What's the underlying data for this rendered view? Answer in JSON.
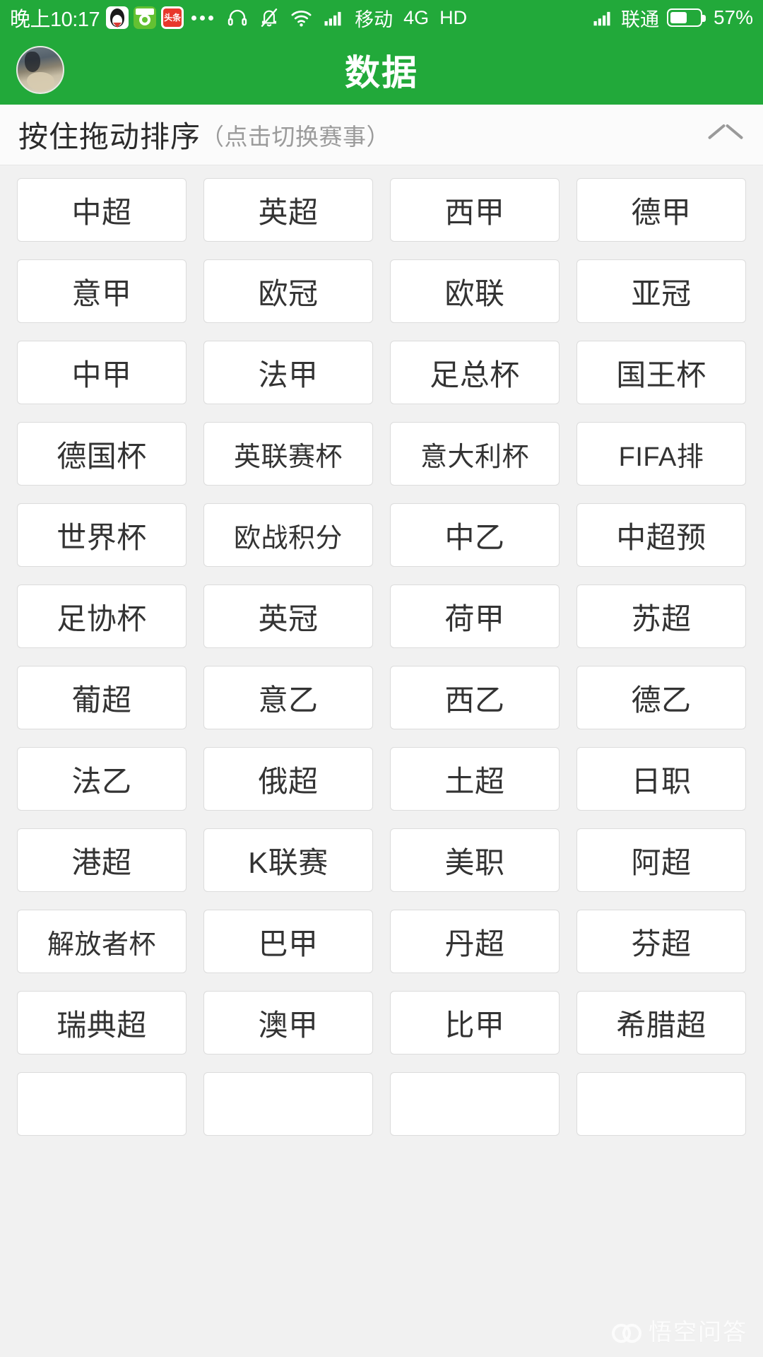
{
  "status_bar": {
    "time": "晚上10:17",
    "app_icons": [
      "qq-icon",
      "green-ball-app-icon",
      "toutiao-icon"
    ],
    "toutiao_label": "头条",
    "overflow_dots": "...",
    "headset_icon": "headset-icon",
    "mute_bell_icon": "bell-muted-icon",
    "wifi_icon": "wifi-icon",
    "signal_icon_1": "signal-bars-icon",
    "carrier_1": "移动",
    "network_type": "4G",
    "hd_label": "HD",
    "signal_icon_2": "signal-bars-icon",
    "carrier_2": "联通",
    "battery_icon": "battery-icon",
    "battery_percent": "57%",
    "battery_level": 57
  },
  "app_bar": {
    "avatar": "user-avatar",
    "title": "数据"
  },
  "section_header": {
    "main_text": "按住拖动排序",
    "sub_text": "（点击切换赛事）",
    "collapse_icon": "chevron-up-icon"
  },
  "grid": {
    "columns": 4,
    "tiles": [
      "中超",
      "英超",
      "西甲",
      "德甲",
      "意甲",
      "欧冠",
      "欧联",
      "亚冠",
      "中甲",
      "法甲",
      "足总杯",
      "国王杯",
      "德国杯",
      "英联赛杯",
      "意大利杯",
      "FIFA排",
      "世界杯",
      "欧战积分",
      "中乙",
      "中超预",
      "足协杯",
      "英冠",
      "荷甲",
      "苏超",
      "葡超",
      "意乙",
      "西乙",
      "德乙",
      "法乙",
      "俄超",
      "土超",
      "日职",
      "港超",
      "K联赛",
      "美职",
      "阿超",
      "解放者杯",
      "巴甲",
      "丹超",
      "芬超",
      "瑞典超",
      "澳甲",
      "比甲",
      "希腊超",
      "",
      "",
      "",
      ""
    ]
  },
  "watermark": {
    "logo": "wukong-wenda-logo",
    "text": "悟空问答"
  },
  "colors": {
    "brand_green": "#22a93a",
    "page_background": "#f1f1f1",
    "tile_background": "#ffffff",
    "tile_border": "#dcdcdc",
    "tile_text": "#333333",
    "section_sub_text": "#9b9b9b"
  }
}
